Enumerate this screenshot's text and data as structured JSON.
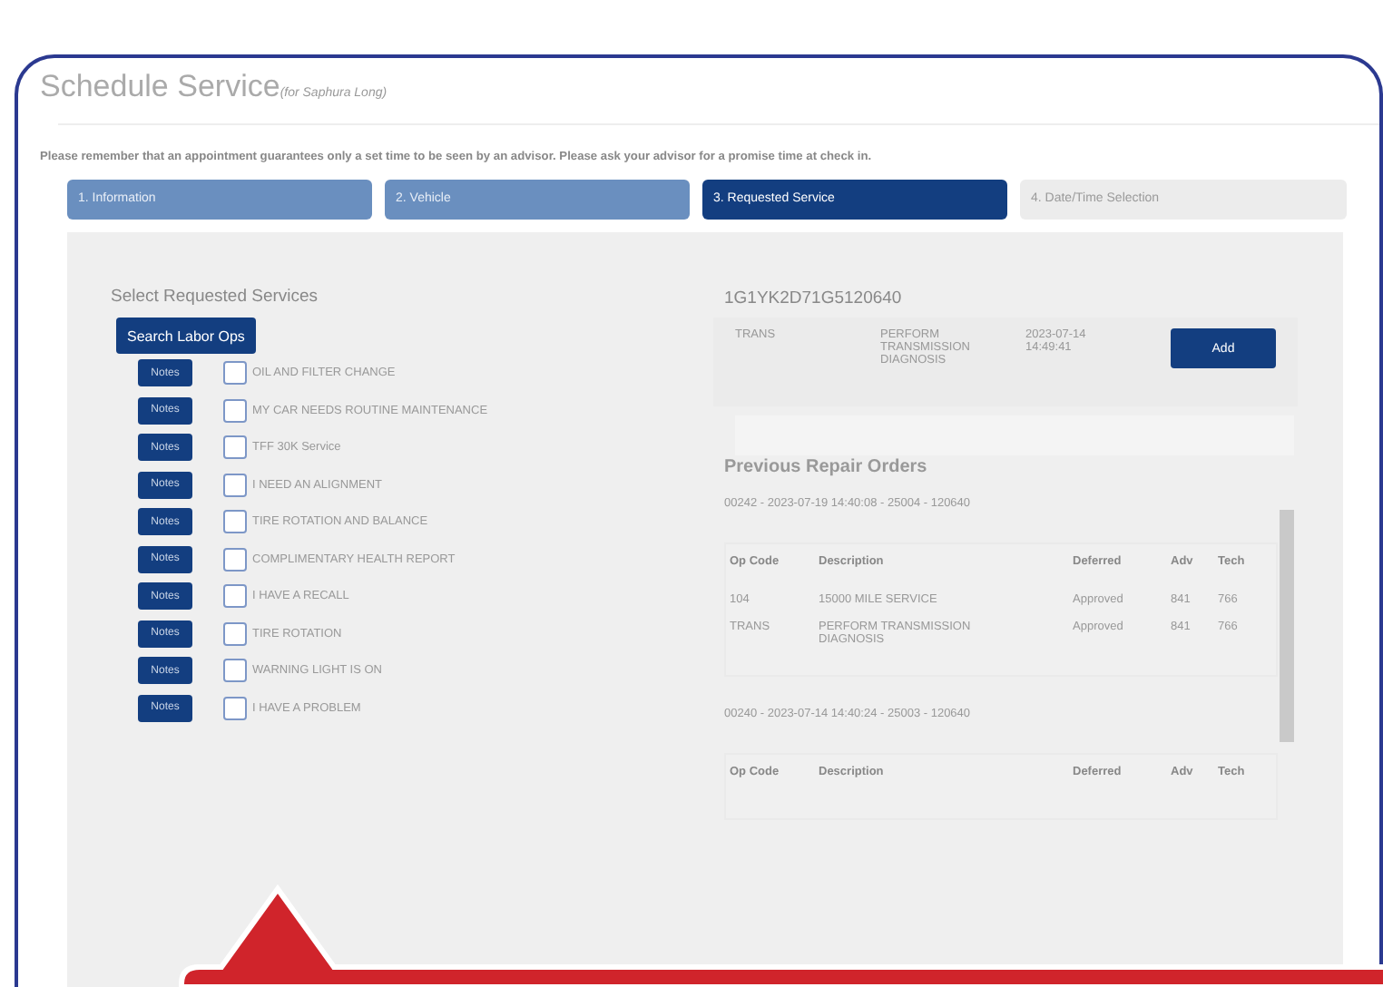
{
  "window": {
    "title": "Schedule Service",
    "subtitle": "(for Saphura Long)"
  },
  "notice": "Please remember that an appointment guarantees only a set time to be seen by an advisor. Please ask your advisor for a promise time at check in.",
  "steps": [
    {
      "label": "1. Information",
      "selected": false,
      "disabled": false
    },
    {
      "label": "2. Vehicle",
      "selected": false,
      "disabled": false
    },
    {
      "label": "3. Requested Service",
      "selected": true,
      "disabled": false
    },
    {
      "label": "4. Date/Time Selection",
      "selected": false,
      "disabled": true
    }
  ],
  "services": {
    "heading": "Select Requested Services",
    "search_button": "Search Labor Ops",
    "items": [
      {
        "notes": "Notes",
        "label": "OIL AND FILTER CHANGE",
        "checked": false
      },
      {
        "notes": "Notes",
        "label": "MY CAR NEEDS ROUTINE MAINTENANCE",
        "checked": false
      },
      {
        "notes": "Notes",
        "label": "TFF 30K Service",
        "checked": false
      },
      {
        "notes": "Notes",
        "label": "I NEED AN ALIGNMENT",
        "checked": false
      },
      {
        "notes": "Notes",
        "label": "TIRE ROTATION AND BALANCE",
        "checked": false
      },
      {
        "notes": "Notes",
        "label": "COMPLIMENTARY HEALTH REPORT",
        "checked": false
      },
      {
        "notes": "Notes",
        "label": "I HAVE A RECALL",
        "checked": false
      },
      {
        "notes": "Notes",
        "label": "TIRE ROTATION",
        "checked": false
      },
      {
        "notes": "Notes",
        "label": "WARNING LIGHT IS ON",
        "checked": false
      },
      {
        "notes": "Notes",
        "label": "I HAVE A PROBLEM",
        "checked": false
      }
    ]
  },
  "recommendations": {
    "vin": "1G1YK2D71G5120640",
    "rows": [
      {
        "code": "TRANS",
        "description": "PERFORM TRANSMISSION DIAGNOSIS",
        "date": "2023-07-14 14:49:41",
        "button": "Add"
      }
    ]
  },
  "previous_orders": {
    "heading": "Previous Repair Orders",
    "orders": [
      {
        "header": "00242 - 2023-07-19 14:40:08 - 25004 - 120640",
        "columns": [
          "Op Code",
          "Description",
          "Deferred",
          "Adv",
          "Tech"
        ],
        "rows": [
          [
            "104",
            "15000 MILE SERVICE",
            "Approved",
            "841",
            "766"
          ],
          [
            "TRANS",
            "PERFORM TRANSMISSION DIAGNOSIS",
            "Approved",
            "841",
            "766"
          ]
        ]
      },
      {
        "header": "00240 - 2023-07-14 14:40:24 - 25003 - 120640",
        "columns": [
          "Op Code",
          "Description",
          "Deferred",
          "Adv",
          "Tech"
        ]
      }
    ]
  }
}
